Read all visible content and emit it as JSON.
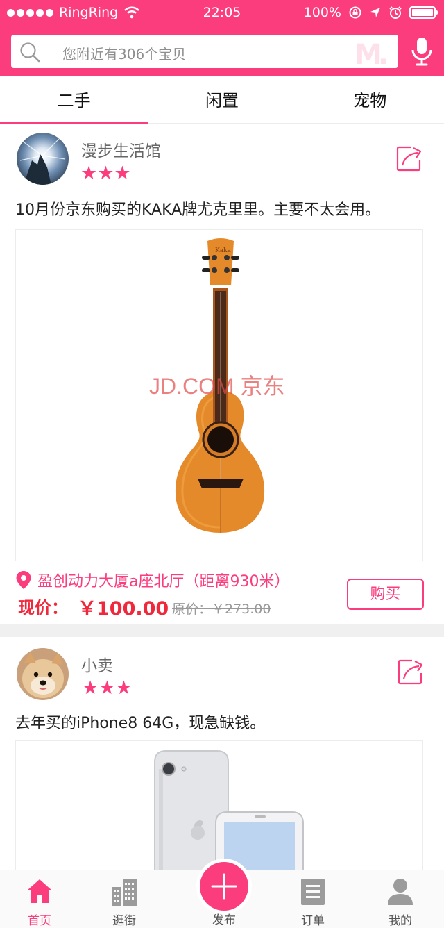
{
  "status_bar": {
    "carrier": "RingRing",
    "time": "22:05",
    "battery": "100%"
  },
  "search": {
    "placeholder": "您附近有306个宝贝",
    "logo_text": "M."
  },
  "tabs": [
    {
      "label": "二手",
      "active": true
    },
    {
      "label": "闲置",
      "active": false
    },
    {
      "label": "宠物",
      "active": false
    }
  ],
  "items": [
    {
      "seller": "漫步生活馆",
      "stars": "★★★",
      "description": "10月份京东购买的KAKA牌尤克里里。主要不太会用。",
      "photo_watermark": "JD.COM 京东",
      "location": "盈创动力大厦a座北厅（距离930米）",
      "price_label": "现价：",
      "price": "￥100.00",
      "original_price": "原价：￥273.00",
      "buy_label": "购买"
    },
    {
      "seller": "小卖",
      "stars": "★★★",
      "description": "去年买的iPhone8 64G，现急缺钱。"
    }
  ],
  "tabbar": {
    "home": "首页",
    "browse": "逛街",
    "publish": "发布",
    "orders": "订单",
    "mine": "我的"
  },
  "colors": {
    "accent": "#fc3d7d",
    "price": "#f0283b"
  }
}
